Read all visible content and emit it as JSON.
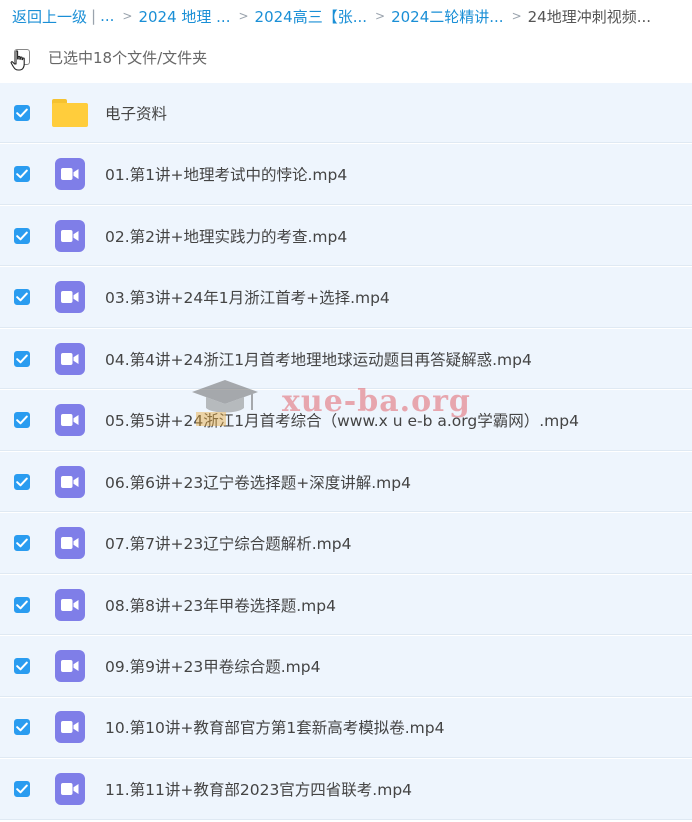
{
  "breadcrumb": {
    "back_label": "返回上一级",
    "ellipsis": "...",
    "divider": "|",
    "items": [
      "2024 地理 ...",
      "2024高三【张...",
      "2024二轮精讲...",
      "24地理冲刺视频..."
    ]
  },
  "selection": {
    "label": "已选中18个文件/文件夹"
  },
  "files": [
    {
      "name": "电子资料",
      "type": "folder",
      "checked": true
    },
    {
      "name": "01.第1讲+地理考试中的悖论.mp4",
      "type": "video",
      "checked": true
    },
    {
      "name": "02.第2讲+地理实践力的考查.mp4",
      "type": "video",
      "checked": true
    },
    {
      "name": "03.第3讲+24年1月浙江首考+选择.mp4",
      "type": "video",
      "checked": true
    },
    {
      "name": "04.第4讲+24浙江1月首考地理地球运动题目再答疑解惑.mp4",
      "type": "video",
      "checked": true
    },
    {
      "name": "05.第5讲+24浙江1月首考综合（www.x u e-b a.org学霸网）.mp4",
      "type": "video",
      "checked": true
    },
    {
      "name": "06.第6讲+23辽宁卷选择题+深度讲解.mp4",
      "type": "video",
      "checked": true
    },
    {
      "name": "07.第7讲+23辽宁综合题解析.mp4",
      "type": "video",
      "checked": true
    },
    {
      "name": "08.第8讲+23年甲卷选择题.mp4",
      "type": "video",
      "checked": true
    },
    {
      "name": "09.第9讲+23甲卷综合题.mp4",
      "type": "video",
      "checked": true
    },
    {
      "name": "10.第10讲+教育部官方第1套新高考模拟卷.mp4",
      "type": "video",
      "checked": true
    },
    {
      "name": "11.第11讲+教育部2023官方四省联考.mp4",
      "type": "video",
      "checked": true
    }
  ],
  "watermark": {
    "text": "xue-ba.org"
  },
  "colors": {
    "accent": "#2a9cf0",
    "link": "#1a8fd6",
    "row_bg": "#eef5fd",
    "video_icon": "#7f7ee8",
    "folder_icon": "#ffcd3c"
  },
  "icons": {
    "checkbox": "checkbox-checked-icon",
    "folder": "folder-icon",
    "video": "video-file-icon",
    "cursor": "hand-cursor-icon",
    "watermark": "graduation-cap-icon"
  }
}
